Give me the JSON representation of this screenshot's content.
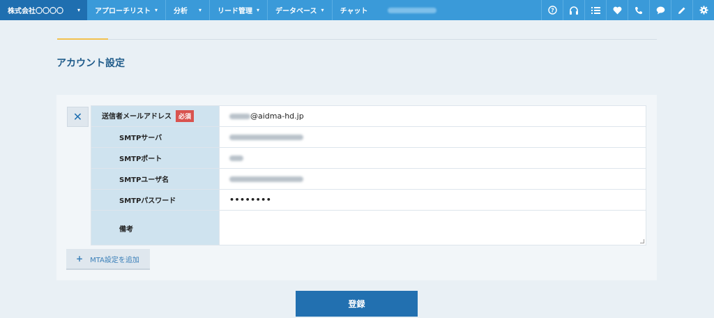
{
  "header": {
    "company": "株式会社〇〇〇〇",
    "nav": [
      {
        "label": "アプローチリスト"
      },
      {
        "label": "分析"
      },
      {
        "label": "リード管理"
      },
      {
        "label": "データベース"
      },
      {
        "label": "チャット"
      }
    ],
    "icons": [
      "help-icon",
      "headset-icon",
      "list-icon",
      "heart-icon",
      "phone-icon",
      "chat-bubble-icon",
      "pencil-icon",
      "gear-icon"
    ]
  },
  "page": {
    "title": "アカウント設定"
  },
  "form": {
    "sender_email": {
      "label": "送信者メールアドレス",
      "required": "必須",
      "value_suffix": "@aidma-hd.jp"
    },
    "smtp_server": {
      "label": "SMTPサーバ"
    },
    "smtp_port": {
      "label": "SMTPポート"
    },
    "smtp_user": {
      "label": "SMTPユーザ名"
    },
    "smtp_password": {
      "label": "SMTPパスワード",
      "value": "••••••••"
    },
    "memo": {
      "label": "備考",
      "value": ""
    }
  },
  "buttons": {
    "add_mta": "MTA設定を追加",
    "submit": "登録"
  },
  "colors": {
    "nav": "#3a9ad9",
    "company": "#1f6fb0",
    "primary": "#2270b0",
    "required": "#d9534f",
    "accent": "#f2c14e"
  }
}
